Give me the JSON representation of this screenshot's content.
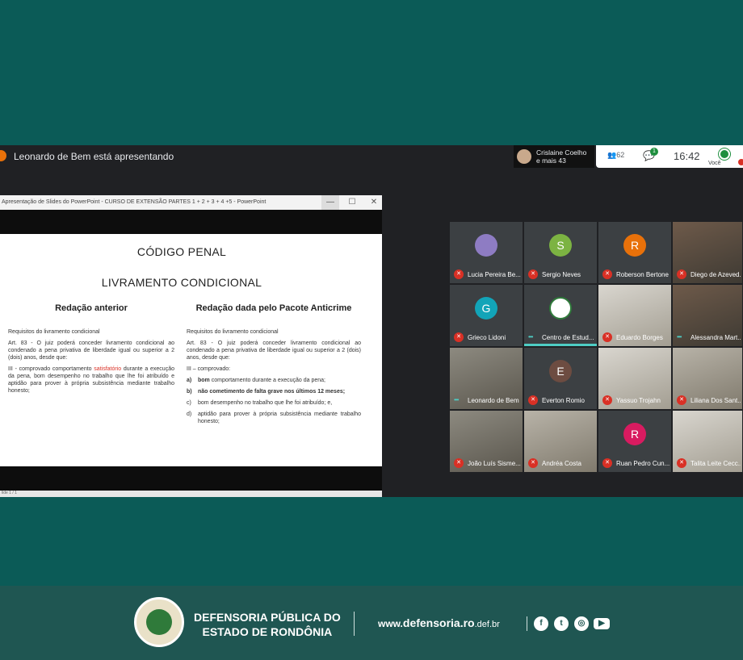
{
  "meet": {
    "presenting_text": "Leonardo de Bem está apresentando",
    "pinned_name": "Crislaine Coelho",
    "pinned_more": "e mais 43",
    "participant_count": "62",
    "chat_badge": "1",
    "time": "16:42",
    "you_label": "Você"
  },
  "ppt": {
    "window_title": "Apresentação de Slides do PowerPoint - CURSO DE EXTENSÃO PARTES 1 + 2 + 3 + 4 +5 - PowerPoint",
    "btn_min": "—",
    "btn_max": "☐",
    "btn_close": "✕",
    "status": "lide 1 / 1"
  },
  "slide": {
    "title": "CÓDIGO PENAL",
    "subtitle": "LIVRAMENTO CONDICIONAL",
    "left": {
      "heading": "Redação anterior",
      "req": "Requisitos do livramento condicional",
      "art": "Art. 83 - O juiz poderá conceder livramento condicional ao condenado a pena privativa de liberdade igual ou superior a 2 (dois) anos, desde que:",
      "iii_pre": "III - comprovado comportamento ",
      "iii_red": "satisfatório",
      "iii_post": " durante a execução da pena, bom desempenho no trabalho que lhe foi atribuído e aptidão para prover à própria subsistência mediante trabalho honesto;"
    },
    "right": {
      "heading": "Redação dada pelo Pacote Anticrime",
      "req": "Requisitos do livramento condicional",
      "art": "Art. 83 - O juiz poderá conceder livramento condicional ao condenado a pena privativa de liberdade igual ou superior a 2 (dois) anos, desde que:",
      "iii": "III – comprovado:",
      "a_key": "a)",
      "a_bold": "bom",
      "a_rest": " comportamento durante a execução da pena;",
      "b_key": "b)",
      "b_text": "não cometimento de falta grave nos últimos 12 meses;",
      "c_key": "c)",
      "c_text": "bom desempenho no trabalho que lhe foi atribuído; e,",
      "d_key": "d)",
      "d_text": "aptidão para prover à própria subsistência mediante trabalho honesto;"
    }
  },
  "participants": [
    {
      "name": "Lucia Pereira Be...",
      "initial": ""
    },
    {
      "name": "Sergio Neves",
      "initial": "S"
    },
    {
      "name": "Roberson Bertone",
      "initial": "R"
    },
    {
      "name": "Diego de Azeved...",
      "initial": ""
    },
    {
      "name": "Grieco Lidoni",
      "initial": "G"
    },
    {
      "name": "Centro de Estud...",
      "initial": ""
    },
    {
      "name": "Eduardo Borges",
      "initial": ""
    },
    {
      "name": "Alessandra Mart...",
      "initial": ""
    },
    {
      "name": "Leonardo de Bem",
      "initial": ""
    },
    {
      "name": "Everton Romio",
      "initial": "E"
    },
    {
      "name": "Yassuo Trojahn",
      "initial": ""
    },
    {
      "name": "Liliana Dos Sant...",
      "initial": ""
    },
    {
      "name": "João Luís Sisme...",
      "initial": ""
    },
    {
      "name": "Andréa Costa",
      "initial": ""
    },
    {
      "name": "Ruan Pedro Cun...",
      "initial": "R"
    },
    {
      "name": "Talita Leite Cecc...",
      "initial": ""
    }
  ],
  "colors": {
    "green": "#7cb342",
    "orange": "#e8710a",
    "teal": "#12a4b8",
    "brown": "#6d4c41",
    "pink": "#d81b60"
  },
  "footer": {
    "org_line1": "DEFENSORIA PÚBLICA DO",
    "org_line2": "ESTADO DE RONDÔNIA",
    "site_www": "www.",
    "site_main": "defensoria.ro",
    "site_tld": ".def.br",
    "icons": [
      "facebook-icon",
      "twitter-icon",
      "instagram-icon",
      "youtube-icon"
    ]
  }
}
